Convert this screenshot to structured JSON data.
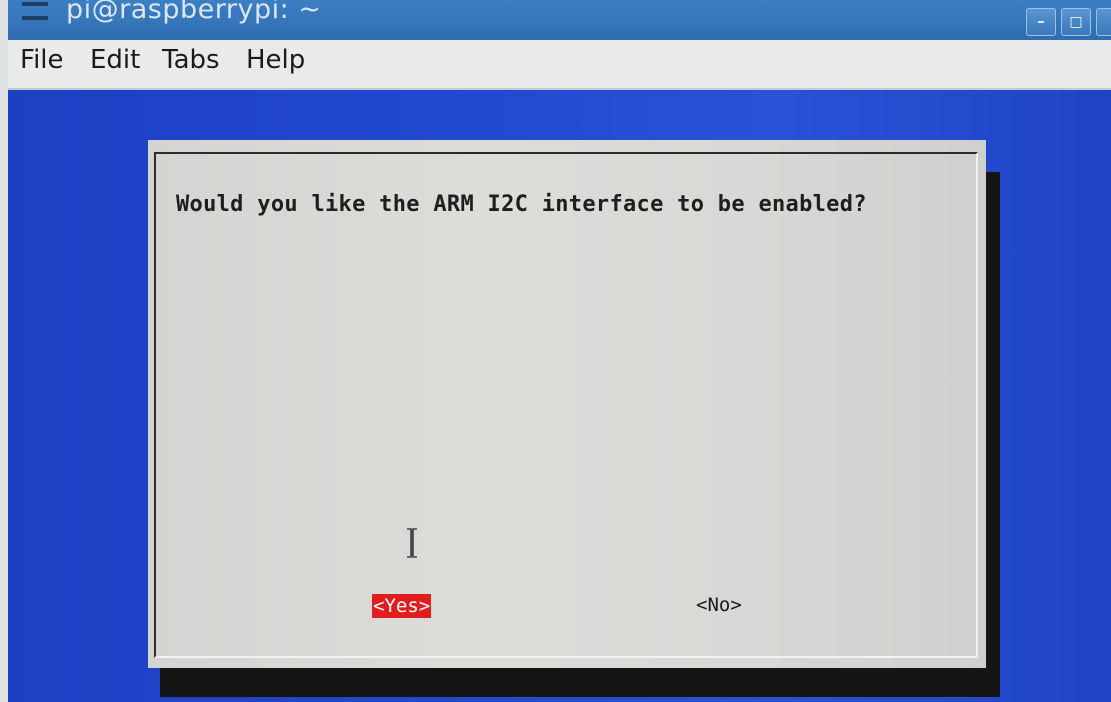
{
  "window": {
    "title": "pi@raspberrypi: ~",
    "minimize_label": "–",
    "maximize_label": "□",
    "close_label": ""
  },
  "menubar": {
    "items": [
      "File",
      "Edit",
      "Tabs",
      "Help"
    ]
  },
  "dialog": {
    "message": "Would you like the ARM I2C interface to be enabled?",
    "yes_label": "<Yes>",
    "no_label": "<No>",
    "selected_button": "yes"
  },
  "colors": {
    "terminal_background": "#2149cf",
    "dialog_background": "#d9d9d6",
    "selected_button_background": "#e01e1e",
    "titlebar": "#3577bb"
  },
  "icons": {
    "title": "terminal-icon",
    "cursor": "ibeam-cursor-icon"
  }
}
